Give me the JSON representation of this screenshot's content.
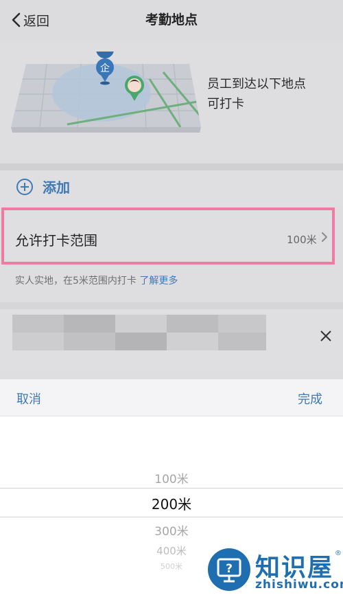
{
  "header": {
    "back_label": "返回",
    "title": "考勤地点"
  },
  "hero": {
    "line1": "员工到达以下地点",
    "line2": "可打卡",
    "map_marker_icon": "enterprise-pin-icon",
    "avatar_icon": "employee-avatar-pin-icon"
  },
  "add": {
    "label": "添加",
    "icon": "plus-circle-icon"
  },
  "range": {
    "label": "允许打卡范围",
    "value": "100米",
    "icon": "chevron-right-icon"
  },
  "hint": {
    "text": "实人实地，在5米范围内打卡",
    "link": "了解更多"
  },
  "picker": {
    "cancel_label": "取消",
    "done_label": "完成",
    "options": [
      "100米",
      "200米",
      "300米",
      "400米",
      "500米"
    ],
    "selected": "200米"
  },
  "watermark": {
    "brand": "知识屋",
    "url": "zhishiwu.com",
    "reg": "®"
  },
  "colors": {
    "accent": "#3f79b5",
    "highlight_border": "#f07aa0",
    "watermark": "#1f6fb0"
  }
}
